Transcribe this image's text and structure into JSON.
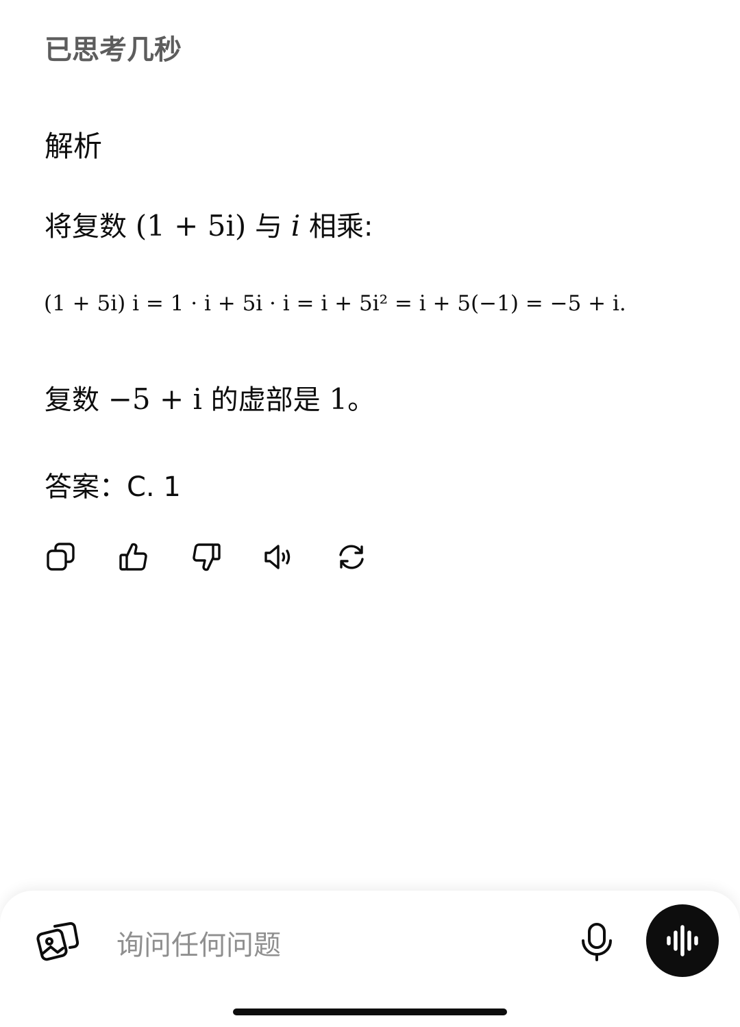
{
  "status": {
    "thinking_label": "已思考几秒"
  },
  "answer": {
    "heading": "解析",
    "p1": {
      "prefix": "将复数 ",
      "expr": "(1 + 5i)",
      "mid": " 与 ",
      "var": "i",
      "suffix": " 相乘:"
    },
    "equation": "(1 + 5i) i = 1 · i + 5i · i = i + 5i² = i + 5(−1) = −5 + i.",
    "p3": {
      "prefix": "复数 ",
      "expr": "−5 + i",
      "mid": " 的虚部是 ",
      "value": "1",
      "suffix": "。"
    },
    "final": "答案：C. 1"
  },
  "actions": [
    {
      "name": "copy-icon"
    },
    {
      "name": "thumbs-up-icon"
    },
    {
      "name": "thumbs-down-icon"
    },
    {
      "name": "read-aloud-icon"
    },
    {
      "name": "regenerate-icon"
    }
  ],
  "composer": {
    "placeholder": "询问任何问题",
    "attach_icon": "image-attach-icon",
    "mic_icon": "microphone-icon",
    "voice_icon": "voice-mode-icon"
  }
}
